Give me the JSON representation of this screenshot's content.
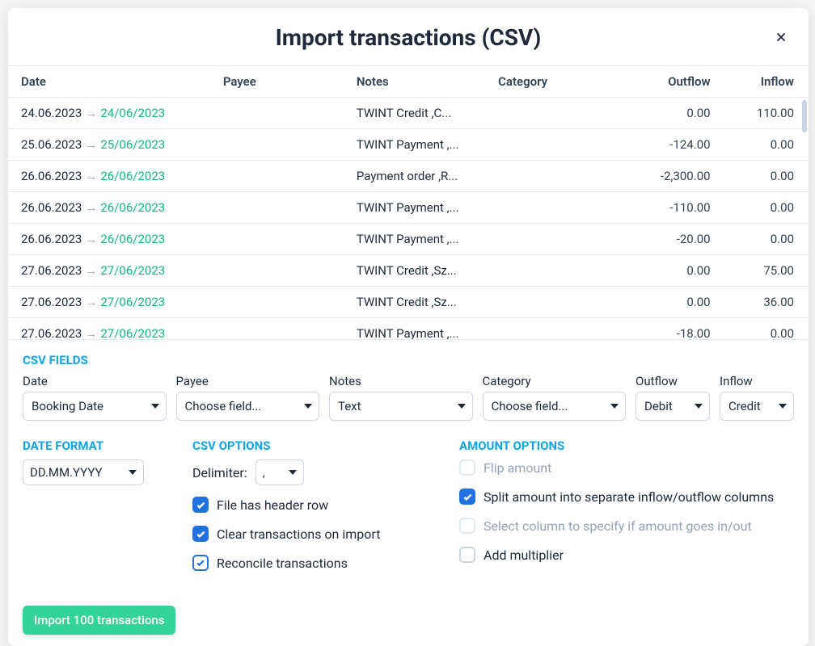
{
  "modal": {
    "title": "Import transactions (CSV)"
  },
  "table": {
    "headers": {
      "date": "Date",
      "payee": "Payee",
      "notes": "Notes",
      "category": "Category",
      "outflow": "Outflow",
      "inflow": "Inflow"
    },
    "rows": [
      {
        "date_raw": "24.06.2023",
        "date_parsed": "24/06/2023",
        "payee": "",
        "notes": "TWINT Credit ,C...",
        "category": "",
        "outflow": "0.00",
        "inflow": "110.00"
      },
      {
        "date_raw": "25.06.2023",
        "date_parsed": "25/06/2023",
        "payee": "",
        "notes": "TWINT Payment ,...",
        "category": "",
        "outflow": "-124.00",
        "inflow": "0.00"
      },
      {
        "date_raw": "26.06.2023",
        "date_parsed": "26/06/2023",
        "payee": "",
        "notes": "Payment order ,R...",
        "category": "",
        "outflow": "-2,300.00",
        "inflow": "0.00"
      },
      {
        "date_raw": "26.06.2023",
        "date_parsed": "26/06/2023",
        "payee": "",
        "notes": "TWINT Payment ,...",
        "category": "",
        "outflow": "-110.00",
        "inflow": "0.00"
      },
      {
        "date_raw": "26.06.2023",
        "date_parsed": "26/06/2023",
        "payee": "",
        "notes": "TWINT Payment ,...",
        "category": "",
        "outflow": "-20.00",
        "inflow": "0.00"
      },
      {
        "date_raw": "27.06.2023",
        "date_parsed": "27/06/2023",
        "payee": "",
        "notes": "TWINT Credit ,Sz...",
        "category": "",
        "outflow": "0.00",
        "inflow": "75.00"
      },
      {
        "date_raw": "27.06.2023",
        "date_parsed": "27/06/2023",
        "payee": "",
        "notes": "TWINT Credit ,Sz...",
        "category": "",
        "outflow": "0.00",
        "inflow": "36.00"
      },
      {
        "date_raw": "27.06.2023",
        "date_parsed": "27/06/2023",
        "payee": "",
        "notes": "TWINT Payment ,...",
        "category": "",
        "outflow": "-18.00",
        "inflow": "0.00"
      }
    ]
  },
  "csv_fields": {
    "title": "CSV FIELDS",
    "labels": {
      "date": "Date",
      "payee": "Payee",
      "notes": "Notes",
      "category": "Category",
      "outflow": "Outflow",
      "inflow": "Inflow"
    },
    "values": {
      "date": "Booking Date",
      "payee": "Choose field...",
      "notes": "Text",
      "category": "Choose field...",
      "outflow": "Debit",
      "inflow": "Credit"
    }
  },
  "date_format": {
    "title": "DATE FORMAT",
    "value": "DD.MM.YYYY"
  },
  "csv_options": {
    "title": "CSV OPTIONS",
    "delimiter_label": "Delimiter:",
    "delimiter_value": ",",
    "has_header": "File has header row",
    "clear_on_import": "Clear transactions on import",
    "reconcile": "Reconcile transactions"
  },
  "amount_options": {
    "title": "AMOUNT OPTIONS",
    "flip": "Flip amount",
    "split": "Split amount into separate inflow/outflow columns",
    "select_col": "Select column to specify if amount goes in/out",
    "multiplier": "Add multiplier"
  },
  "import_button": "Import 100 transactions"
}
